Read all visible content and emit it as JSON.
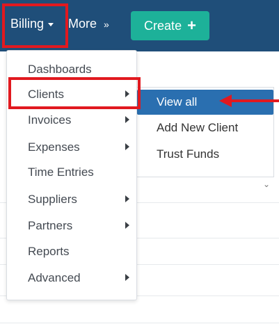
{
  "topnav": {
    "billing_label": "Billing",
    "more_label": "More",
    "more_icon": "double-chevron-down-icon",
    "create_label": "Create",
    "create_icon": "plus-icon"
  },
  "billing_menu": {
    "items": [
      {
        "label": "Dashboards",
        "has_submenu": false
      },
      {
        "label": "Clients",
        "has_submenu": true
      },
      {
        "label": "Invoices",
        "has_submenu": true
      },
      {
        "label": "Expenses",
        "has_submenu": true
      },
      {
        "label": "Time Entries",
        "has_submenu": false
      },
      {
        "label": "Suppliers",
        "has_submenu": true
      },
      {
        "label": "Partners",
        "has_submenu": true
      },
      {
        "label": "Reports",
        "has_submenu": false
      },
      {
        "label": "Advanced",
        "has_submenu": true
      }
    ]
  },
  "clients_submenu": {
    "items": [
      {
        "label": "View all",
        "active": true
      },
      {
        "label": "Add New Client",
        "active": false
      },
      {
        "label": "Trust Funds",
        "active": false
      }
    ]
  },
  "colors": {
    "navbar": "#1f4e79",
    "create_button": "#1db199",
    "active_item": "#2a6fb0",
    "highlight": "#e1191f"
  }
}
